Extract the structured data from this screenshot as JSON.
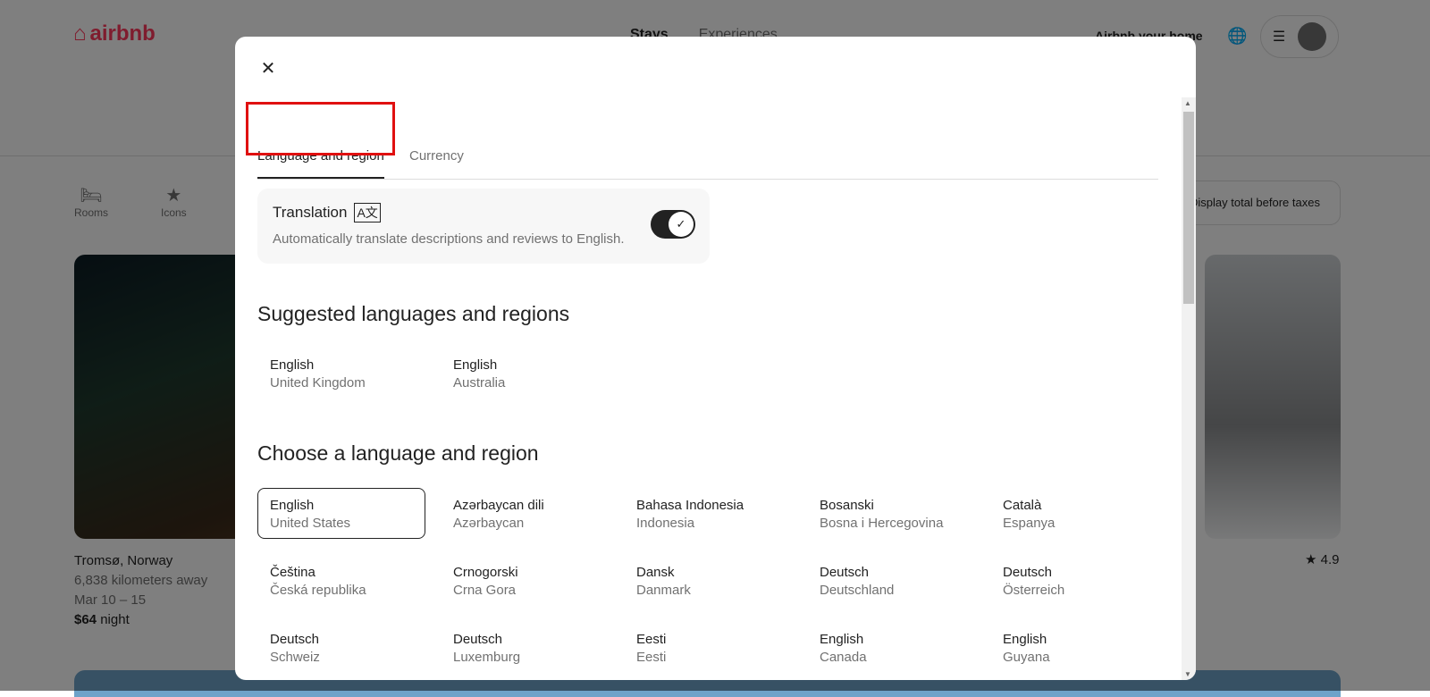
{
  "header": {
    "logo": "airbnb",
    "nav": [
      "Stays",
      "Experiences"
    ],
    "host_link": "Airbnb your home"
  },
  "categories": [
    "Rooms",
    "Icons"
  ],
  "taxes_toggle": "Display total before taxes",
  "listing": {
    "title": "Tromsø, Norway",
    "distance": "6,838 kilometers away",
    "dates": "Mar 10 – 15",
    "price": "$64",
    "price_unit": "night",
    "rating": "4.9"
  },
  "modal": {
    "tabs": [
      {
        "label": "Language and region",
        "active": true
      },
      {
        "label": "Currency",
        "active": false
      }
    ],
    "translation": {
      "title": "Translation",
      "description": "Automatically translate descriptions and reviews to English.",
      "enabled": true
    },
    "suggested_heading": "Suggested languages and regions",
    "suggested": [
      {
        "language": "English",
        "region": "United Kingdom"
      },
      {
        "language": "English",
        "region": "Australia"
      }
    ],
    "choose_heading": "Choose a language and region",
    "options": [
      {
        "language": "English",
        "region": "United States",
        "selected": true
      },
      {
        "language": "Azərbaycan dili",
        "region": "Azərbaycan"
      },
      {
        "language": "Bahasa Indonesia",
        "region": "Indonesia"
      },
      {
        "language": "Bosanski",
        "region": "Bosna i Hercegovina"
      },
      {
        "language": "Català",
        "region": "Espanya"
      },
      {
        "language": "Čeština",
        "region": "Česká republika"
      },
      {
        "language": "Crnogorski",
        "region": "Crna Gora"
      },
      {
        "language": "Dansk",
        "region": "Danmark"
      },
      {
        "language": "Deutsch",
        "region": "Deutschland"
      },
      {
        "language": "Deutsch",
        "region": "Österreich"
      },
      {
        "language": "Deutsch",
        "region": "Schweiz"
      },
      {
        "language": "Deutsch",
        "region": "Luxemburg"
      },
      {
        "language": "Eesti",
        "region": "Eesti"
      },
      {
        "language": "English",
        "region": "Canada"
      },
      {
        "language": "English",
        "region": "Guyana"
      }
    ]
  },
  "colors": {
    "brand": "#ff385c",
    "highlight": "#e01010"
  }
}
